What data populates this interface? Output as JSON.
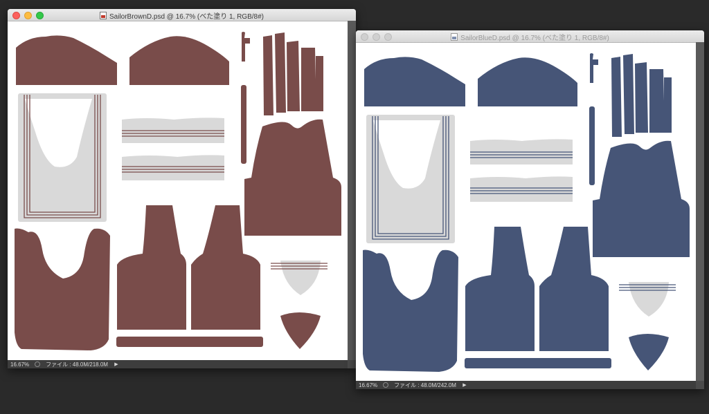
{
  "windows": [
    {
      "title": "SailorBrownD.psd @ 16.7% (べた塗り 1, RGB/8#)",
      "zoom": "16.67%",
      "file_info": "ファイル : 48.0M/218.0M",
      "active": true,
      "fabric_color": "#794c4a",
      "stripe_color": "#794c4a"
    },
    {
      "title": "SailorBlueD.psd @ 16.7% (べた塗り 1, RGB/8#)",
      "zoom": "16.67%",
      "file_info": "ファイル : 48.0M/242.0M",
      "active": false,
      "fabric_color": "#465577",
      "stripe_color": "#465577"
    }
  ],
  "colors": {
    "desktop": "#2a2a2a",
    "gray_panel": "#d9d9d9",
    "status_bar": "#3d3d3d"
  },
  "icons": {
    "document": "psd-document-icon",
    "status_menu": "triangle-right-icon"
  }
}
